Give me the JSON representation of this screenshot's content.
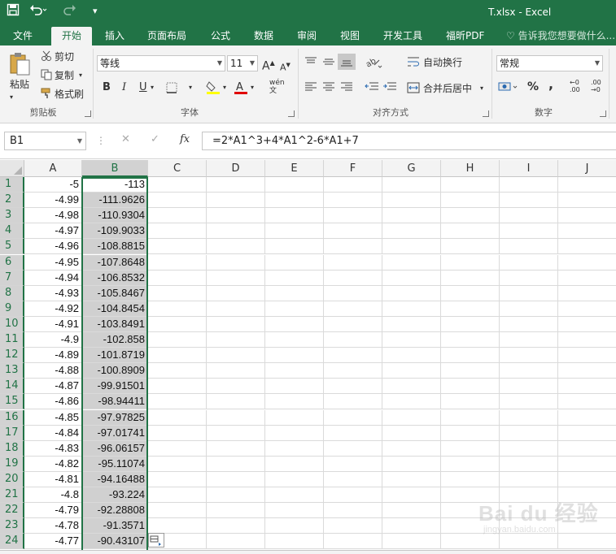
{
  "window": {
    "title": "T.xlsx - Excel"
  },
  "ribbon_tabs": [
    "文件",
    "开始",
    "插入",
    "页面布局",
    "公式",
    "数据",
    "审阅",
    "视图",
    "开发工具",
    "福昕PDF"
  ],
  "active_tab": "开始",
  "tell_me": "告诉我您想要做什么...",
  "clipboard": {
    "paste": "粘贴",
    "cut": "剪切",
    "copy": "复制",
    "format_painter": "格式刷",
    "label": "剪贴板"
  },
  "font": {
    "name": "等线",
    "size": "11",
    "label": "字体",
    "bold": "B",
    "italic": "I",
    "underline": "U",
    "phonetic": "wén"
  },
  "alignment": {
    "wrap": "自动换行",
    "merge": "合并后居中",
    "label": "对齐方式"
  },
  "number": {
    "format": "常规",
    "label": "数字",
    "percent": "%",
    "comma": ",",
    "inc_decimal": ".00",
    "dec_decimal": ".00"
  },
  "formula_bar": {
    "name_box": "B1",
    "fx": "fx",
    "cancel": "✕",
    "enter": "✓",
    "formula": "=2*A1^3+4*A1^2-6*A1+7"
  },
  "sheet": {
    "columns": [
      "A",
      "B",
      "C",
      "D",
      "E",
      "F",
      "G",
      "H",
      "I",
      "J"
    ],
    "rows": [
      [
        "1",
        "-5",
        "-113"
      ],
      [
        "2",
        "-4.99",
        "-111.9626"
      ],
      [
        "3",
        "-4.98",
        "-110.9304"
      ],
      [
        "4",
        "-4.97",
        "-109.9033"
      ],
      [
        "5",
        "-4.96",
        "-108.8815"
      ],
      [
        "6",
        "-4.95",
        "-107.8648"
      ],
      [
        "7",
        "-4.94",
        "-106.8532"
      ],
      [
        "8",
        "-4.93",
        "-105.8467"
      ],
      [
        "9",
        "-4.92",
        "-104.8454"
      ],
      [
        "10",
        "-4.91",
        "-103.8491"
      ],
      [
        "11",
        "-4.9",
        "-102.858"
      ],
      [
        "12",
        "-4.89",
        "-101.8719"
      ],
      [
        "13",
        "-4.88",
        "-100.8909"
      ],
      [
        "14",
        "-4.87",
        "-99.91501"
      ],
      [
        "15",
        "-4.86",
        "-98.94411"
      ],
      [
        "16",
        "-4.85",
        "-97.97825"
      ],
      [
        "17",
        "-4.84",
        "-97.01741"
      ],
      [
        "18",
        "-4.83",
        "-96.06157"
      ],
      [
        "19",
        "-4.82",
        "-95.11074"
      ],
      [
        "20",
        "-4.81",
        "-94.16488"
      ],
      [
        "21",
        "-4.8",
        "-93.224"
      ],
      [
        "22",
        "-4.79",
        "-92.28808"
      ],
      [
        "23",
        "-4.78",
        "-91.3571"
      ],
      [
        "24",
        "-4.77",
        "-90.43107"
      ]
    ]
  },
  "watermark": {
    "brand": "Bai du 经验",
    "url": "jingyan.baidu.com"
  },
  "colors": {
    "accent": "#217346",
    "selection": "#d0d0d0"
  }
}
